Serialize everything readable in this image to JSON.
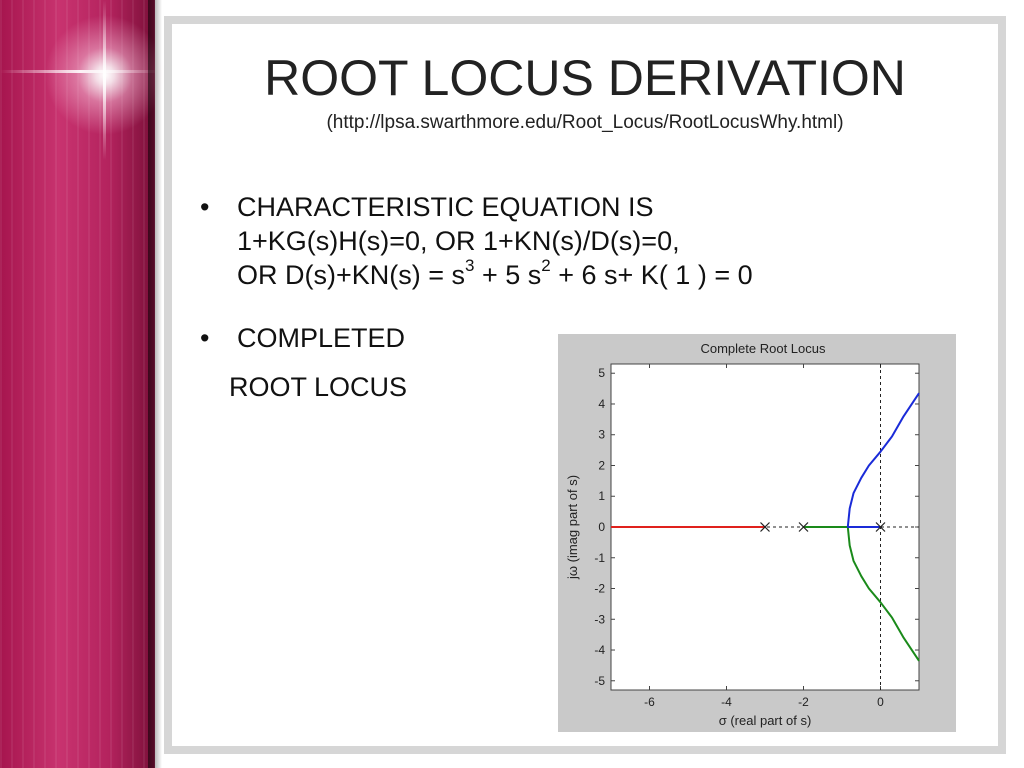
{
  "slide": {
    "title": "ROOT LOCUS DERIVATION",
    "subtitle": "(http://lpsa.swarthmore.edu/Root_Locus/RootLocusWhy.html)",
    "bullets": [
      {
        "marker": "•",
        "line1": "CHARACTERISTIC EQUATION IS",
        "line2": "1+KG(s)H(s)=0, OR 1+KN(s)/D(s)=0,",
        "line3_a": "OR D(s)+KN(s) = s",
        "line3_sup1": "3",
        "line3_b": " + 5 s",
        "line3_sup2": "2",
        "line3_c": " + 6 s+ K( 1 ) = 0"
      },
      {
        "marker": "•",
        "line1": "COMPLETED",
        "line2": "ROOT LOCUS"
      }
    ]
  },
  "chart_data": {
    "type": "line",
    "title": "Complete Root Locus",
    "xlabel": "σ (real part of s)",
    "ylabel": "jω (imag part of s)",
    "xlim": [
      -7,
      1
    ],
    "ylim": [
      -5.3,
      5.3
    ],
    "xticks": [
      -6,
      -4,
      -2,
      0
    ],
    "yticks": [
      -5,
      -4,
      -3,
      -2,
      -1,
      0,
      1,
      2,
      3,
      4,
      5
    ],
    "poles": [
      [
        -3,
        0
      ],
      [
        -2,
        0
      ],
      [
        0,
        0
      ]
    ],
    "dashed_lines": [
      "real axis",
      "imaginary axis"
    ],
    "colors": {
      "red": "#e0211d",
      "green": "#1a8a1a",
      "blue": "#1a2bd8"
    },
    "series": [
      {
        "color": "red",
        "points": [
          [
            -3,
            0
          ],
          [
            -7,
            0
          ]
        ]
      },
      {
        "color": "green",
        "points": [
          [
            -2,
            0
          ],
          [
            -0.85,
            0
          ],
          [
            -0.8,
            -0.6
          ],
          [
            -0.7,
            -1.1
          ],
          [
            -0.5,
            -1.6
          ],
          [
            -0.3,
            -2.0
          ],
          [
            0,
            -2.45
          ],
          [
            0.3,
            -2.95
          ],
          [
            0.6,
            -3.6
          ],
          [
            1,
            -4.35
          ]
        ]
      },
      {
        "color": "blue",
        "points": [
          [
            0,
            0
          ],
          [
            -0.85,
            0
          ],
          [
            -0.8,
            0.6
          ],
          [
            -0.7,
            1.1
          ],
          [
            -0.5,
            1.6
          ],
          [
            -0.3,
            2.0
          ],
          [
            0,
            2.45
          ],
          [
            0.3,
            2.95
          ],
          [
            0.6,
            3.6
          ],
          [
            1,
            4.35
          ]
        ]
      }
    ]
  }
}
